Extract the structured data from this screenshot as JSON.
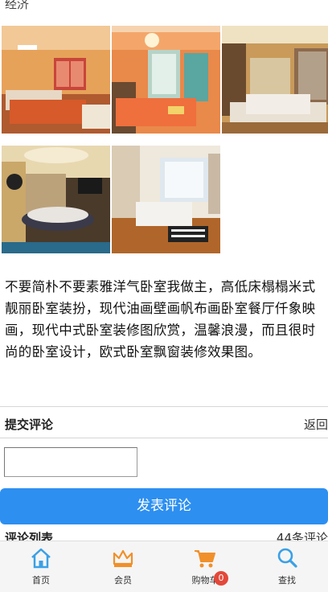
{
  "top_fragment": "经济",
  "gallery": {
    "images": [
      {
        "name": "bedroom-photo-1"
      },
      {
        "name": "bedroom-photo-2"
      },
      {
        "name": "bedroom-photo-3"
      },
      {
        "name": "bedroom-photo-4"
      },
      {
        "name": "bedroom-photo-5"
      }
    ]
  },
  "description": "不要简朴不要素雅洋气卧室我做主，高低床榻榻米式靓丽卧室装扮，现代油画壁画帆布画卧室餐厅仟象映画，现代中式卧室装修图欣赏，温馨浪漫，而且很时尚的卧室设计，欧式卧室飘窗装修效果图。",
  "comment_section": {
    "title": "提交评论",
    "back_label": "返回",
    "input_value": "",
    "submit_label": "发表评论"
  },
  "comment_list": {
    "title": "评论列表",
    "count_label": "44条评论"
  },
  "tabbar": {
    "items": [
      {
        "label": "首页",
        "icon": "home-icon"
      },
      {
        "label": "会员",
        "icon": "crown-icon"
      },
      {
        "label": "购物车",
        "icon": "cart-icon",
        "badge": "0"
      },
      {
        "label": "查找",
        "icon": "search-icon"
      }
    ]
  },
  "colors": {
    "accent": "#2d8ff0",
    "icon_blue": "#3aa0e6",
    "icon_orange": "#f0902a",
    "badge_red": "#e3483a"
  }
}
